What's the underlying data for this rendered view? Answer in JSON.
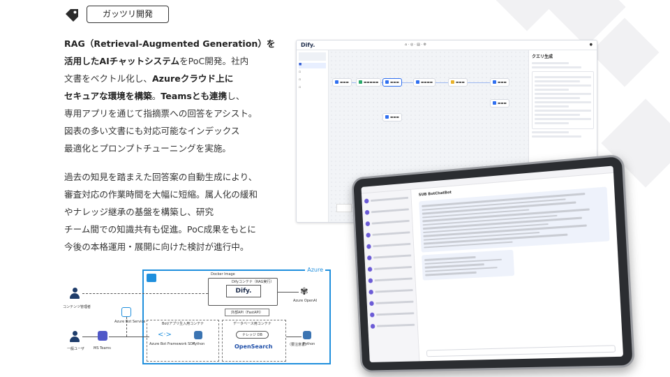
{
  "tag": {
    "label": "ガッツリ開発",
    "icon": "tag-icon"
  },
  "paragraph1": {
    "l1a": "RAG（Retrieval-Augmented Generation）を",
    "l2a": "活用したAIチャットシステム",
    "l2b": "をPoC開発。社内",
    "l3a": "文書をベクトル化し、",
    "l3b": "Azureクラウド上に",
    "l4a": "セキュアな環境を構築",
    "l4b": "。",
    "l4c": "Teamsとも連携",
    "l4d": "し、",
    "l5": "専用アプリを通じて指摘票への回答をアシスト。",
    "l6": "図表の多い文書にも対応可能なインデックス",
    "l7": "最適化とプロンプトチューニングを実施。"
  },
  "paragraph2": {
    "l1": "過去の知見を踏まえた回答案の自動生成により、",
    "l2": "審査対応の作業時間を大幅に短縮。属人化の緩和",
    "l3": "やナレッジ継承の基盤を構築し、研究",
    "l4": "チーム間での知識共有も促進。PoC成果をもとに",
    "l5": "今後の本格運用・展開に向けた検討が進行中。"
  },
  "screenshot": {
    "app_name": "Dify.",
    "panel_title": "クエリ生成"
  },
  "tablet": {
    "chat_title": "SUB BotChatBot"
  },
  "diagram": {
    "cloud_label": "Azure",
    "user_admin": "コンテンツ管理者",
    "user_general": "一般ユーザ",
    "bot_service": "Azure Bot Service",
    "teams": "MS Teams",
    "docker_image": "Docker Image",
    "dify_container": "Difyコンテナ（RAG実行）",
    "dify_logo": "Dify.",
    "openai": "Azure OpenAI",
    "api_label": "外部API（FastAPI）",
    "bot_container": "Bot/アプリ生入用コンテナ",
    "db_container": "データベース用コンテナ",
    "knowledge": "ナレッジ DB",
    "opensearch": "OpenSearch",
    "sdk": "Azure Bot Framework SDK",
    "python1": "Python",
    "python2": "Python",
    "manual_doc": "（要注意書）"
  },
  "colors": {
    "azure_blue": "#1f8fdd",
    "dify_navy": "#1c2b4a",
    "accent_blue": "#2f6ff0"
  }
}
